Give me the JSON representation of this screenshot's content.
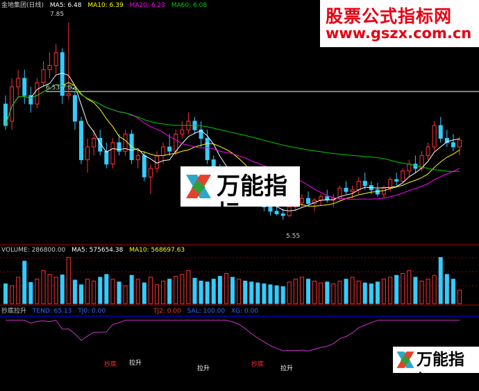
{
  "header": {
    "title": "金地集团(日线)",
    "ma5": "MA5: 6.48",
    "ma10": "MA10: 6.39",
    "ma20": "MA20: 6.23",
    "ma60": "MA60: 6.08"
  },
  "annotations": {
    "high": "7.85",
    "level": "6.53-7.02",
    "low": "5.55"
  },
  "volume_panel": {
    "volume": "VOLUME: 286800.00",
    "ma5": "MA5: 575654.38",
    "ma10": "MA10: 568697.63"
  },
  "indicator_panel": {
    "name": "抄底拉升",
    "tend": "TEND: 65.13",
    "tj0": "TJ0: 0.00",
    "tj2": "TJ2: 0.00",
    "sal": "SAL: 100.00",
    "xg": "XG: 0.00",
    "signals": [
      "抄底",
      "拉升",
      "拉升",
      "抄底",
      "拉升"
    ]
  },
  "watermarks": {
    "top_line1": "股票公式指标网",
    "top_line2": "www.gszx.com.cn",
    "mid": "万能指标",
    "bottom": "万能指标"
  },
  "colors": {
    "up": "#ff3333",
    "down": "#33ccff",
    "ma5": "#ffffff",
    "ma10": "#ffff00",
    "ma20": "#ff00ff",
    "ma60": "#00cc00",
    "grid": "#990000"
  },
  "chart_data": {
    "type": "candlestick",
    "candles": [
      [
        6.9,
        7.0,
        6.6,
        6.65
      ],
      [
        6.7,
        7.2,
        6.6,
        7.1
      ],
      [
        7.1,
        7.3,
        7.0,
        7.2
      ],
      [
        7.2,
        7.3,
        6.9,
        7.0
      ],
      [
        7.0,
        7.1,
        6.8,
        6.9
      ],
      [
        6.9,
        7.2,
        6.85,
        7.15
      ],
      [
        7.15,
        7.4,
        7.1,
        7.3
      ],
      [
        7.3,
        7.5,
        7.2,
        7.35
      ],
      [
        7.35,
        7.6,
        7.25,
        7.5
      ],
      [
        7.5,
        7.55,
        6.9,
        7.0
      ],
      [
        7.0,
        7.85,
        6.95,
        7.02
      ],
      [
        7.0,
        7.05,
        6.6,
        6.7
      ],
      [
        6.7,
        6.75,
        6.2,
        6.25
      ],
      [
        6.25,
        6.5,
        6.1,
        6.4
      ],
      [
        6.4,
        6.6,
        6.3,
        6.5
      ],
      [
        6.5,
        6.6,
        6.3,
        6.35
      ],
      [
        6.35,
        6.45,
        6.15,
        6.2
      ],
      [
        6.2,
        6.5,
        6.15,
        6.45
      ],
      [
        6.45,
        6.55,
        6.3,
        6.35
      ],
      [
        6.35,
        6.6,
        6.3,
        6.55
      ],
      [
        6.55,
        6.6,
        6.2,
        6.25
      ],
      [
        6.25,
        6.35,
        6.15,
        6.3
      ],
      [
        6.3,
        6.35,
        6.0,
        6.05
      ],
      [
        6.05,
        6.2,
        5.85,
        6.15
      ],
      [
        6.15,
        6.35,
        6.1,
        6.3
      ],
      [
        6.3,
        6.45,
        6.2,
        6.4
      ],
      [
        6.4,
        6.55,
        6.3,
        6.35
      ],
      [
        6.35,
        6.6,
        6.3,
        6.55
      ],
      [
        6.55,
        6.7,
        6.5,
        6.6
      ],
      [
        6.6,
        6.8,
        6.55,
        6.7
      ],
      [
        6.7,
        6.75,
        6.55,
        6.6
      ],
      [
        6.6,
        6.7,
        6.4,
        6.5
      ],
      [
        6.5,
        6.6,
        6.2,
        6.25
      ],
      [
        6.25,
        6.3,
        6.05,
        6.1
      ],
      [
        6.1,
        6.2,
        5.95,
        6.0
      ],
      [
        6.0,
        6.1,
        5.9,
        6.05
      ],
      [
        6.05,
        6.1,
        5.85,
        5.9
      ],
      [
        5.9,
        6.0,
        5.8,
        5.95
      ],
      [
        5.95,
        6.05,
        5.85,
        5.9
      ],
      [
        5.9,
        5.95,
        5.75,
        5.8
      ],
      [
        5.8,
        5.85,
        5.7,
        5.75
      ],
      [
        5.75,
        5.8,
        5.65,
        5.7
      ],
      [
        5.7,
        5.75,
        5.6,
        5.65
      ],
      [
        5.65,
        5.7,
        5.6,
        5.62
      ],
      [
        5.62,
        5.68,
        5.55,
        5.6
      ],
      [
        5.6,
        5.72,
        5.58,
        5.7
      ],
      [
        5.7,
        5.8,
        5.65,
        5.75
      ],
      [
        5.75,
        5.85,
        5.7,
        5.8
      ],
      [
        5.8,
        5.88,
        5.72,
        5.74
      ],
      [
        5.74,
        5.8,
        5.65,
        5.78
      ],
      [
        5.78,
        5.85,
        5.72,
        5.82
      ],
      [
        5.82,
        5.9,
        5.75,
        5.78
      ],
      [
        5.78,
        5.85,
        5.7,
        5.8
      ],
      [
        5.8,
        5.95,
        5.78,
        5.92
      ],
      [
        5.92,
        6.0,
        5.85,
        5.88
      ],
      [
        5.88,
        5.95,
        5.8,
        5.9
      ],
      [
        5.9,
        6.05,
        5.85,
        6.0
      ],
      [
        6.0,
        6.1,
        5.9,
        5.95
      ],
      [
        5.95,
        6.0,
        5.85,
        5.9
      ],
      [
        5.9,
        5.98,
        5.82,
        5.85
      ],
      [
        5.85,
        5.95,
        5.8,
        5.92
      ],
      [
        5.92,
        6.05,
        5.88,
        6.02
      ],
      [
        6.02,
        6.1,
        5.95,
        6.0
      ],
      [
        6.0,
        6.15,
        5.98,
        6.12
      ],
      [
        6.12,
        6.25,
        6.05,
        6.2
      ],
      [
        6.2,
        6.3,
        6.1,
        6.15
      ],
      [
        6.15,
        6.35,
        6.12,
        6.3
      ],
      [
        6.3,
        6.45,
        6.25,
        6.4
      ],
      [
        6.4,
        6.7,
        6.35,
        6.65
      ],
      [
        6.65,
        6.75,
        6.45,
        6.5
      ],
      [
        6.5,
        6.6,
        6.4,
        6.45
      ],
      [
        6.45,
        6.55,
        6.35,
        6.4
      ],
      [
        6.4,
        6.52,
        6.3,
        6.48
      ]
    ],
    "volume": [
      420,
      380,
      560,
      900,
      450,
      520,
      700,
      620,
      560,
      610,
      980,
      500,
      400,
      520,
      480,
      560,
      620,
      520,
      460,
      380,
      600,
      520,
      440,
      560,
      400,
      480,
      520,
      580,
      620,
      700,
      540,
      480,
      460,
      520,
      580,
      640,
      560,
      520,
      480,
      460,
      440,
      420,
      400,
      380,
      360,
      460,
      520,
      560,
      520,
      480,
      440,
      460,
      420,
      480,
      520,
      560,
      480,
      440,
      420,
      460,
      520,
      560,
      600,
      640,
      700,
      560,
      480,
      520,
      600,
      980,
      620,
      520,
      287
    ],
    "ylim": [
      5.3,
      8.0
    ]
  }
}
